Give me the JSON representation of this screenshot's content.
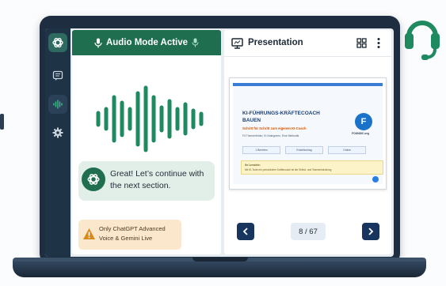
{
  "colors": {
    "brand_green": "#1f6e4f",
    "sidebar": "#1f3347",
    "nav_button": "#183560",
    "warning_bg": "#fbe7cb",
    "headset": "#1f8a5f"
  },
  "sidebar": {
    "items": [
      {
        "icon": "chatgpt-logo-icon",
        "active": true
      },
      {
        "icon": "chat-icon"
      },
      {
        "icon": "audio-wave-icon",
        "selected": true
      },
      {
        "icon": "gear-icon"
      }
    ]
  },
  "audio_panel": {
    "header": "Audio Mode Active",
    "message": "Great! Let’s continue with the next section.",
    "warning": "Only ChatGPT Advanced Voice & Gemini Live"
  },
  "presentation": {
    "title": "Presentation",
    "page_indicator": "8 / 67",
    "slide": {
      "title": "KI-FÜHRUNGS-KRÄFTECOACH BAUEN",
      "subtitle": "Schritt für Schritt zum eigenen KI-Coach",
      "description": "Fit Themenfelder, KI-Kategorien, Eine Methodik",
      "chips": [
        "1 Bereiten",
        "Erstellschlag",
        "Online"
      ],
      "note_title": "Ihr Lernziele:",
      "note_text": "Mit KI-Tools ein persönlicher Kräftecoach ist die Selbst- und Teamentwicklung",
      "logo_letter": "F",
      "logo_text": "FOUNDIC.org"
    }
  }
}
